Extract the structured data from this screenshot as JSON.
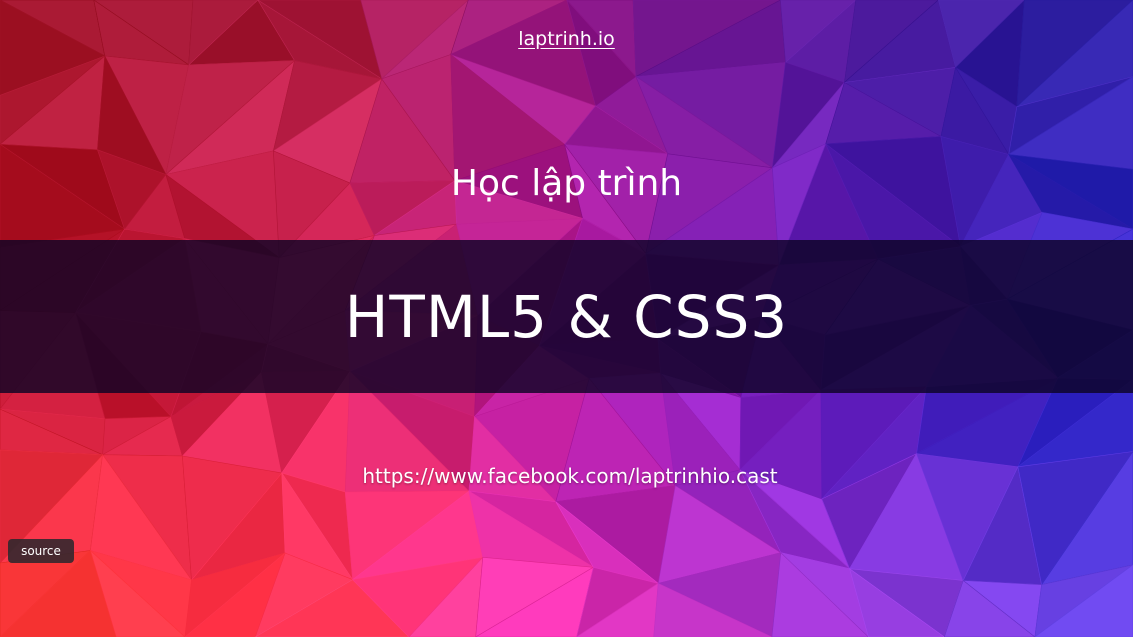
{
  "slide": {
    "site_link": "laptrinh.io",
    "subtitle": "Học lập trình",
    "main_title": "HTML5 & CSS3",
    "facebook_url": "https://www.facebook.com/laptrinhio.cast",
    "source_label": "source"
  },
  "colors": {
    "band": "#0e0426",
    "text": "#ffffff",
    "source_button": "#2d282d",
    "palette": [
      "#c2182b",
      "#e0305a",
      "#a01070",
      "#7a1fb5",
      "#3b20c8",
      "#e84a20",
      "#f07cb8",
      "#2a4fe0"
    ]
  }
}
